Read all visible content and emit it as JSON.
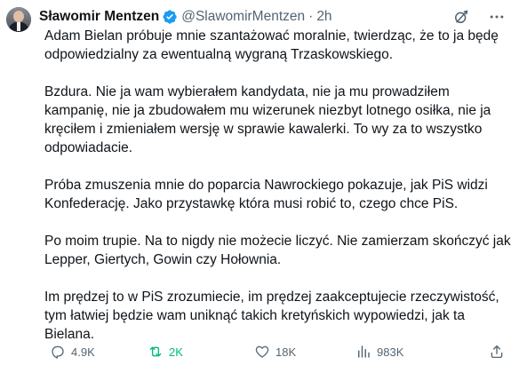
{
  "author": {
    "name": "Sławomir Mentzen",
    "handle": "@SlawomirMentzen",
    "separator": "·",
    "time": "2h"
  },
  "paragraphs": [
    "Adam Bielan próbuje mnie szantażować moralnie, twierdząc, że to ja będę\nodpowiedzialny za ewentualną wygraną Trzaskowskiego.",
    "Bzdura. Nie ja wam wybierałem kandydata, nie ja mu prowadziłem\nkampanię, nie ja zbudowałem mu wizerunek niezbyt lotnego osiłka, nie ja\nkręciłem i zmieniałem wersję w sprawie kawalerki. To wy za to wszystko\nodpowiadacie.",
    "Próba zmuszenia mnie do poparcia Nawrockiego pokazuje, jak PiS widzi\nKonfederację. Jako przystawkę która musi robić to, czego chce PiS.",
    "Po moim trupie. Na to nigdy nie możecie liczyć. Nie zamierzam skończyć jak\nLepper, Giertych, Gowin czy Hołownia.",
    "Im prędzej to w PiS zrozumiecie, im prędzej zaakceptujecie rzeczywistość,\ntym łatwiej będzie wam uniknąć takich kretyńskich wypowiedzi, jak ta\nBielana."
  ],
  "actions": {
    "replies": "4.9K",
    "reposts": "2K",
    "likes": "18K",
    "views": "983K"
  },
  "icons": {
    "verified": "verified-badge-icon",
    "grok": "grok-icon",
    "more": "more-icon",
    "reply": "reply-icon",
    "repost": "repost-icon",
    "like": "heart-icon",
    "views": "views-icon",
    "share": "share-icon"
  },
  "colors": {
    "text": "#0f1419",
    "muted": "#536471",
    "verified": "#1d9bf0",
    "repost_active": "#00ba7c"
  }
}
